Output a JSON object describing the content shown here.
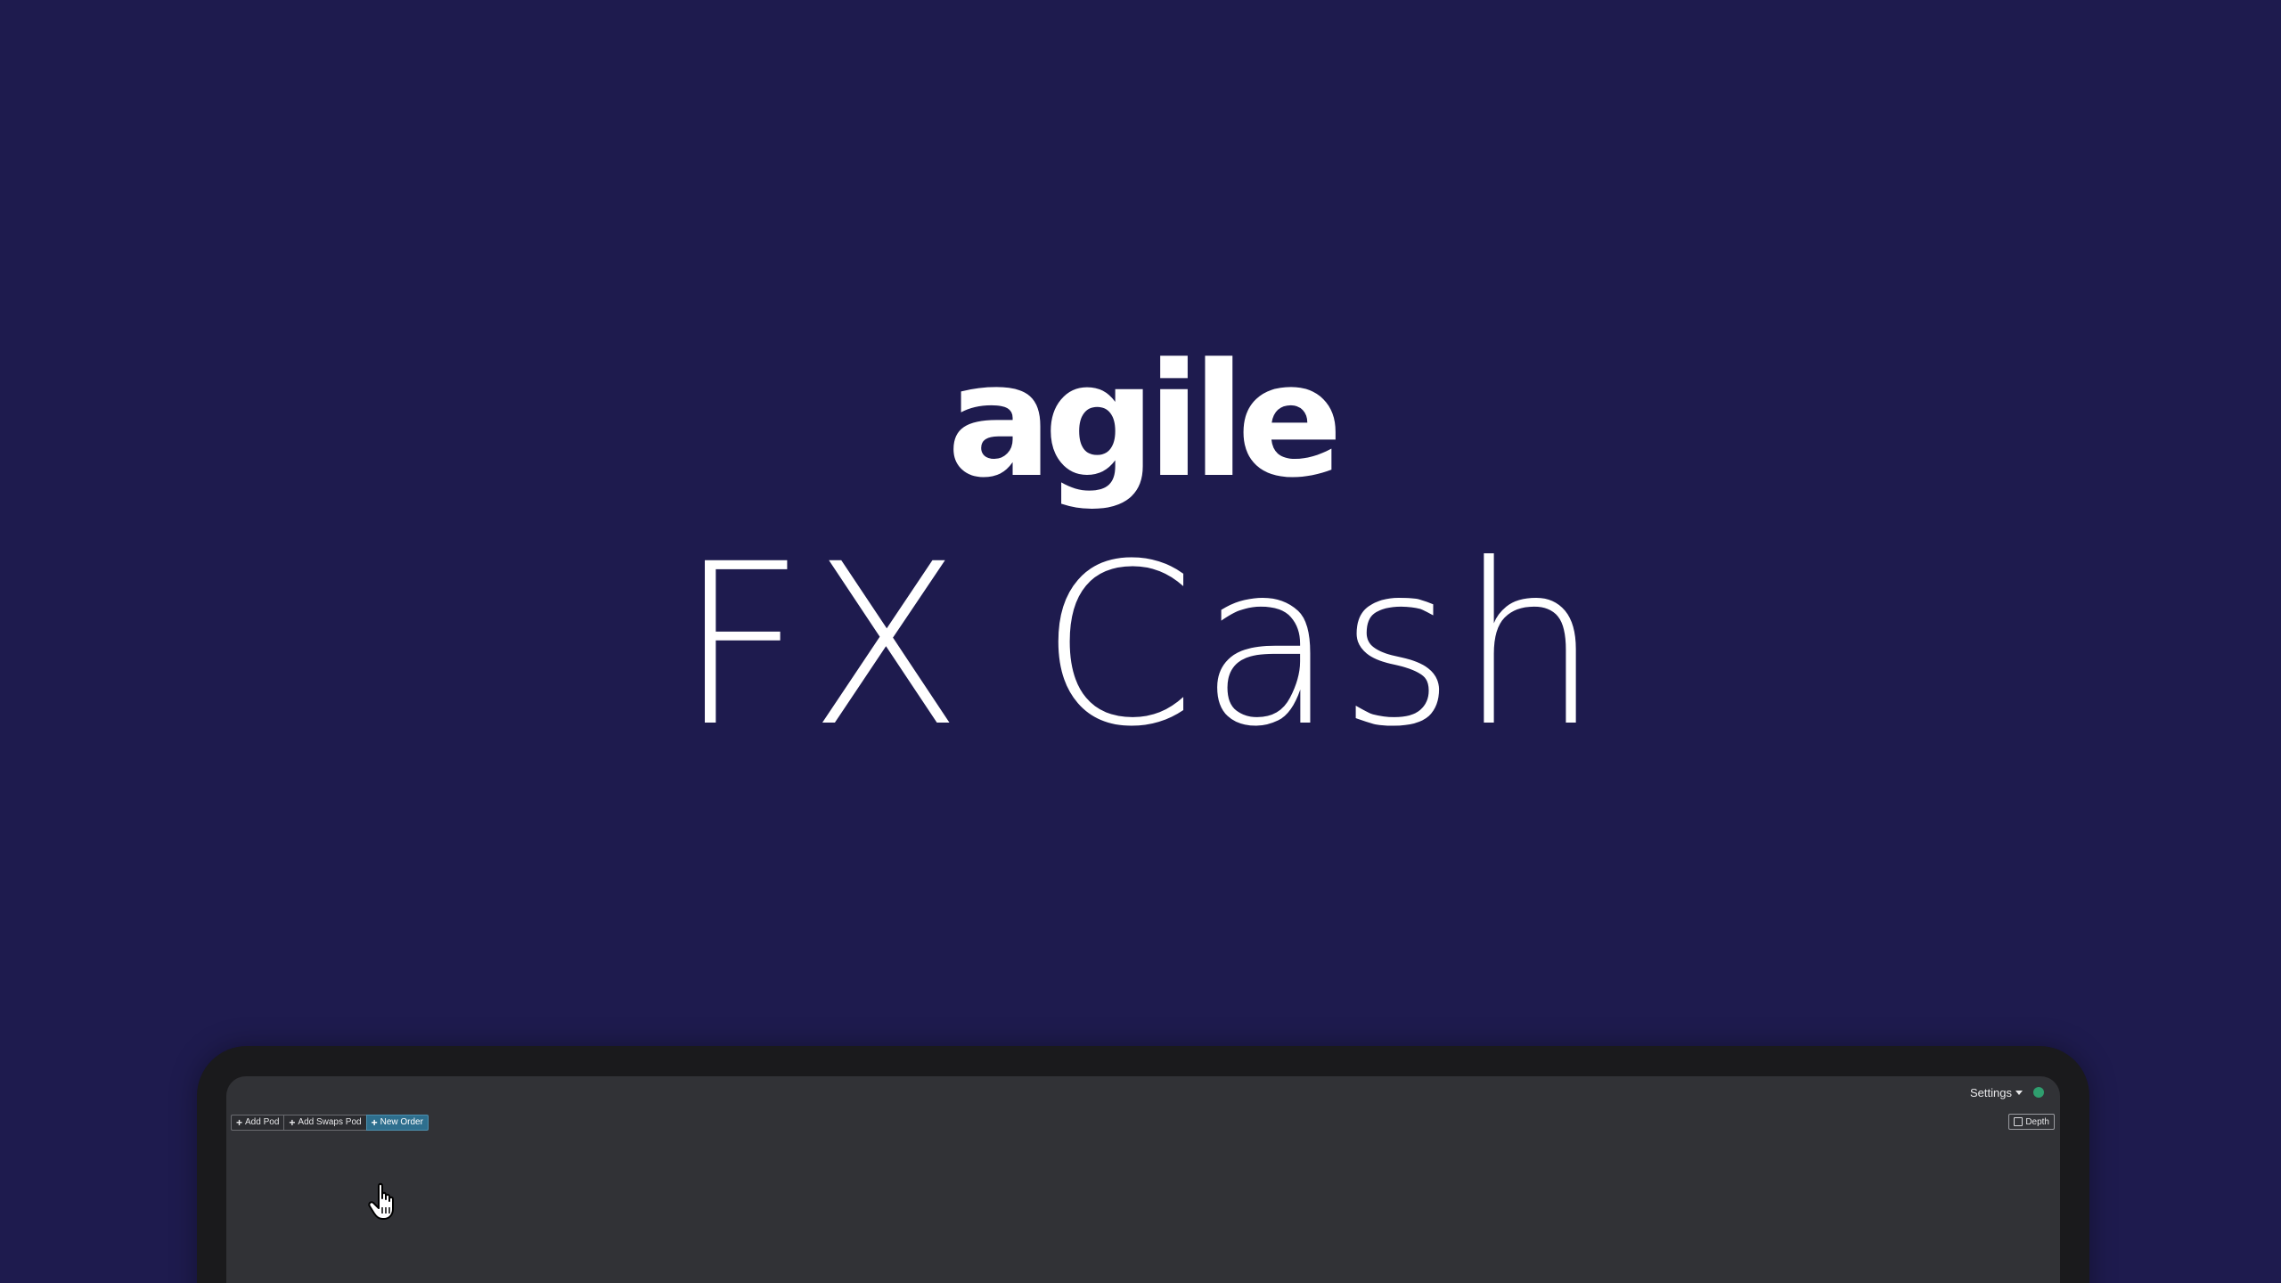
{
  "brand": {
    "logo_text": "agile",
    "product_title": "FX Cash"
  },
  "app": {
    "header": {
      "settings_label": "Settings",
      "status_color": "#2f9e6e"
    },
    "toolbar": {
      "add_pod_label": "Add Pod",
      "add_swaps_pod_label": "Add Swaps Pod",
      "new_order_label": "New Order",
      "depth_label": "Depth"
    }
  },
  "colors": {
    "background": "#1e1b4e",
    "screen": "#313236",
    "primary_button": "#2e6f8e"
  },
  "icons": {
    "plus": "plus-icon",
    "caret": "chevron-down-icon",
    "cursor": "hand-pointer-icon"
  }
}
